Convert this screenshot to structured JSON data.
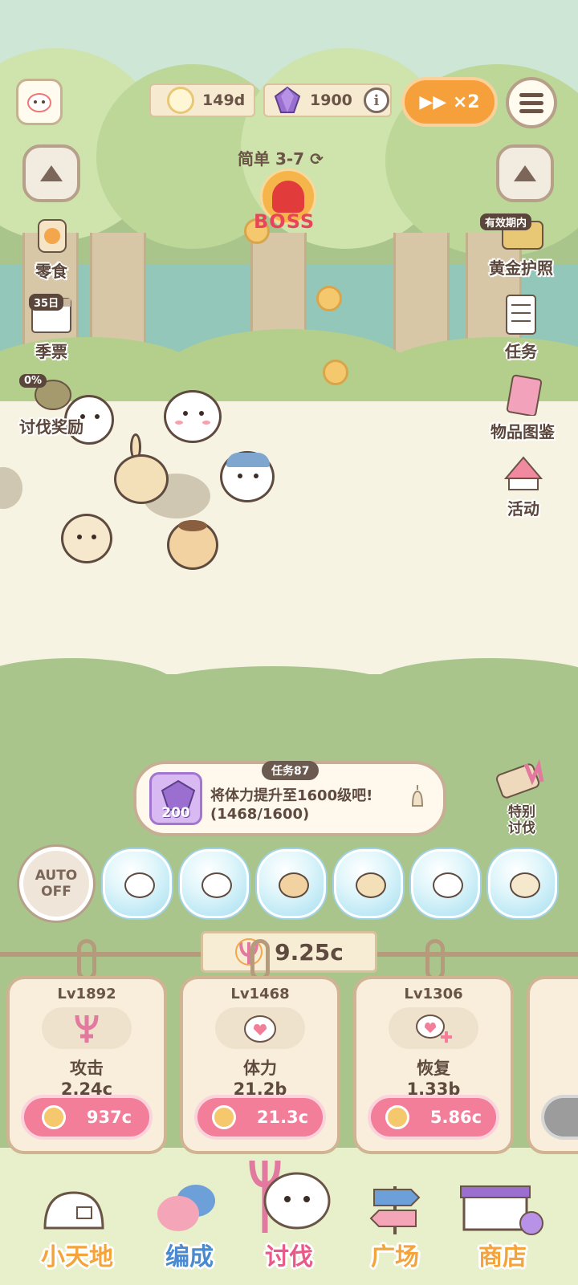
{
  "top_bar": {
    "coins": "149d",
    "gems": "1900",
    "speed_label": "▶▶ ×2"
  },
  "stage": {
    "label": "简单 3-7",
    "boss_label": "BOSS"
  },
  "left_menu": [
    {
      "label": "零食",
      "badge": ""
    },
    {
      "label": "季票",
      "badge": "35日"
    },
    {
      "label": "讨伐奖励",
      "badge": "0%"
    }
  ],
  "right_menu": [
    {
      "label": "黄金护照",
      "badge": "有效期内"
    },
    {
      "label": "任务",
      "badge": ""
    },
    {
      "label": "物品图鉴",
      "badge": ""
    },
    {
      "label": "活动",
      "badge": ""
    }
  ],
  "quest": {
    "tag": "任务87",
    "reward": "200",
    "line1": "将体力提升至1600级吧!",
    "line2": "(1468/1600)"
  },
  "special": {
    "line1": "特别",
    "line2": "讨伐"
  },
  "auto": {
    "line1": "AUTO",
    "line2": "OFF"
  },
  "total_power": "9.25c",
  "cards": [
    {
      "level": "Lv1892",
      "name": "攻击",
      "value": "2.24c",
      "cost": "937c"
    },
    {
      "level": "Lv1468",
      "name": "体力",
      "value": "21.2b",
      "cost": "21.3c"
    },
    {
      "level": "Lv1306",
      "name": "恢复",
      "value": "1.33b",
      "cost": "5.86c"
    }
  ],
  "nav": [
    {
      "label": "小天地"
    },
    {
      "label": "编成"
    },
    {
      "label": "讨伐"
    },
    {
      "label": "广场"
    },
    {
      "label": "商店"
    }
  ],
  "colors": {
    "accent_orange": "#f6a03c",
    "buy_pink": "#f27e9a",
    "boss_red": "#e9445a",
    "gem_purple": "#a276cf"
  }
}
